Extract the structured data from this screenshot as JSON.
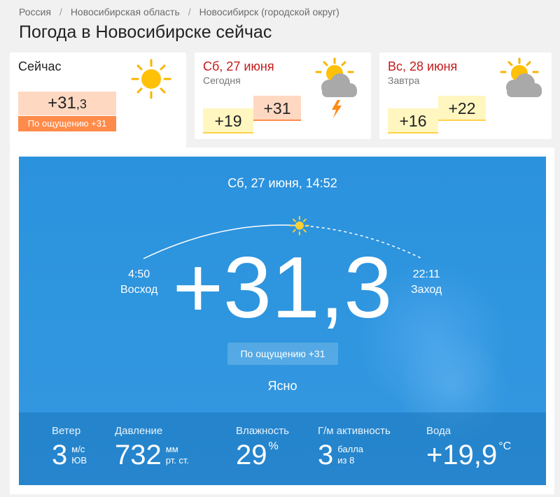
{
  "breadcrumb": {
    "items": [
      "Россия",
      "Новосибирская область",
      "Новосибирск (городской округ)"
    ],
    "separator": "/"
  },
  "page_title": "Погода в Новосибирске сейчас",
  "tabs": {
    "now": {
      "label": "Сейчас",
      "temp_int": "+31",
      "temp_dec": ",3",
      "feels": "По ощущению +31",
      "icon": "sun-icon"
    },
    "day1": {
      "label": "Сб, 27 июня",
      "sub": "Сегодня",
      "low": "+19",
      "high": "+31",
      "icon": "partly-cloudy-thunder-icon"
    },
    "day2": {
      "label": "Вс, 28 июня",
      "sub": "Завтра",
      "low": "+16",
      "high": "+22",
      "icon": "partly-cloudy-icon"
    }
  },
  "hero": {
    "datetime": "Сб, 27 июня, 14:52",
    "sunrise_time": "4:50",
    "sunrise_label": "Восход",
    "sunset_time": "22:11",
    "sunset_label": "Заход",
    "temp": "+31,3",
    "feels": "По ощущению +31",
    "condition": "Ясно",
    "sun_progress": 0.56
  },
  "stats": {
    "wind": {
      "label": "Ветер",
      "value": "3",
      "unit1": "м/с",
      "unit2": "ЮВ"
    },
    "pressure": {
      "label": "Давление",
      "value": "732",
      "unit1": "мм",
      "unit2": "рт. ст."
    },
    "humidity": {
      "label": "Влажность",
      "value": "29",
      "unit1": "%"
    },
    "geomag": {
      "label": "Г/м активность",
      "value": "3",
      "unit1": "балла",
      "unit2": "из 8"
    },
    "water": {
      "label": "Вода",
      "value": "+19,9",
      "unit1": "°C"
    }
  },
  "colors": {
    "accent_red": "#c41b1b",
    "hot": "#ff8b4a",
    "warm": "#ffd24a",
    "hero_blue": "#2f96df"
  }
}
